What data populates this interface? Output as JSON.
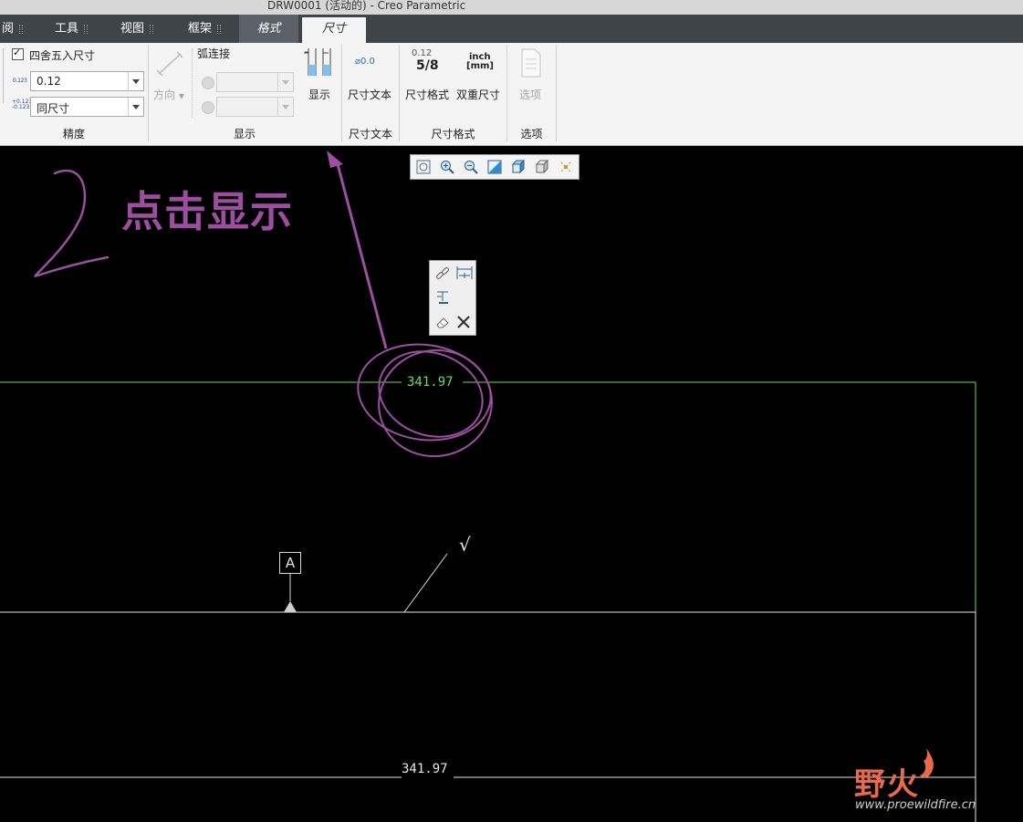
{
  "window": {
    "title": "DRW0001 (活动的) - Creo Parametric"
  },
  "tabs": [
    {
      "label": "阅"
    },
    {
      "label": "工具"
    },
    {
      "label": "视图"
    },
    {
      "label": "框架"
    },
    {
      "label": "格式"
    },
    {
      "label": "尺寸"
    }
  ],
  "ribbon": {
    "precision": {
      "round_checkbox_label": "四舍五入尺寸",
      "decimal_icon_text": "0.123",
      "decimal_value": "0.12",
      "tolerance_icon_text": "+0.123\n-0.123",
      "tolerance_value": "同尺寸",
      "group_label": "精度"
    },
    "display": {
      "direction_label": "方向",
      "arc_join_label": "弧连接",
      "show_button_label": "显示",
      "group_label": "显示"
    },
    "dim_text": {
      "icon_text": "⌀0.0",
      "button_label": "尺寸文本",
      "group_label": "尺寸文本"
    },
    "dim_format": {
      "format_icon_top": "0.12",
      "format_icon_bottom": "5/8",
      "format_button_label": "尺寸格式",
      "dual_icon_top": "inch",
      "dual_icon_bottom": "[mm]",
      "dual_button_label": "双重尺寸",
      "group_label": "尺寸格式"
    },
    "options": {
      "button_label": "选项",
      "group_label": "选项"
    }
  },
  "view_toolbar": {
    "icons": [
      "zoom-fit-icon",
      "zoom-in-icon",
      "zoom-out-icon",
      "repaint-icon",
      "display-style-icon",
      "saved-views-icon",
      "annotation-display-icon"
    ]
  },
  "drawing": {
    "annotation_number": "2",
    "annotation_text": "点击显示",
    "dimension_selected": "341.97",
    "dimension_bottom": "341.97",
    "datum_label": "A",
    "surface_finish_symbol": "√",
    "colors": {
      "annotation": "#9c4ea1",
      "selected_dim": "#5fe05f",
      "drawing_line": "#e6e6e6",
      "background": "#000000"
    }
  },
  "watermark": {
    "name": "野火",
    "url": "www.proewildfire.cn"
  }
}
